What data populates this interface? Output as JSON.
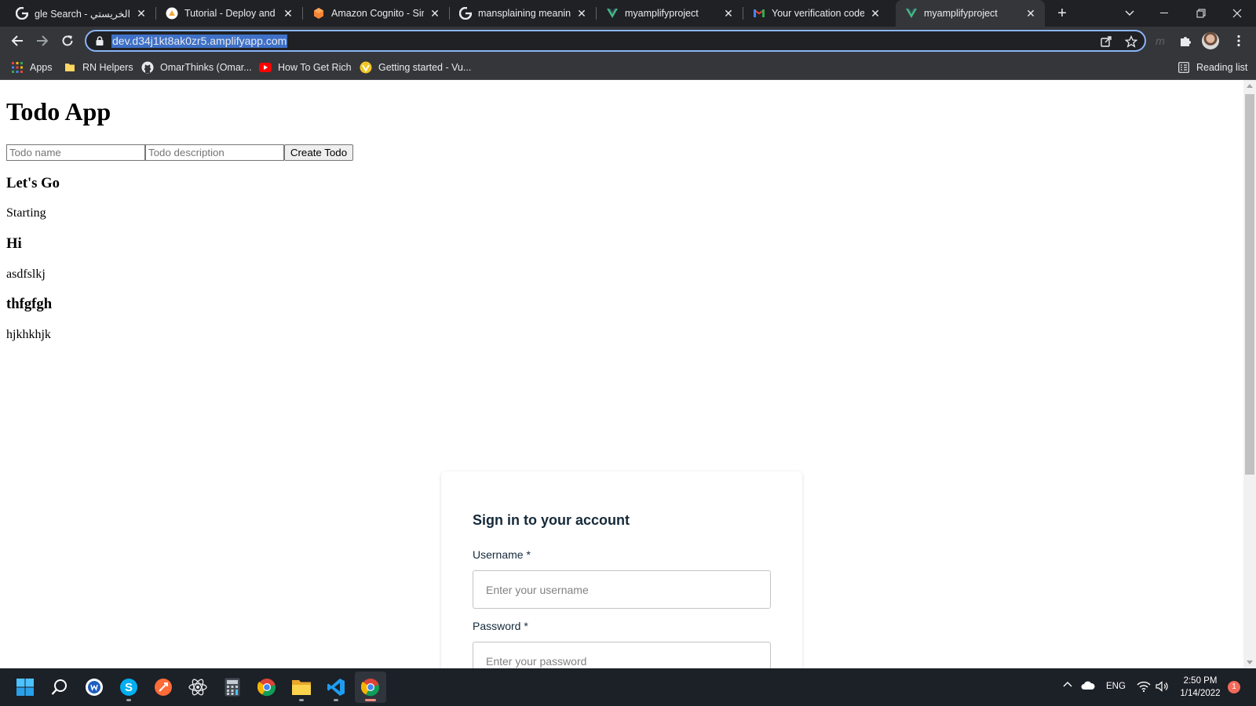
{
  "browser": {
    "tabs": [
      {
        "title": "الخريستي - Google Search",
        "favicon": "google-icon",
        "active": false
      },
      {
        "title": "Tutorial - Deploy and h",
        "favicon": "amplify-docs-icon",
        "active": false
      },
      {
        "title": "Amazon Cognito - Simp",
        "favicon": "aws-cognito-icon",
        "active": false
      },
      {
        "title": "mansplaining meaning",
        "favicon": "google-icon",
        "active": false
      },
      {
        "title": "myamplifyproject",
        "favicon": "vue-icon",
        "active": false
      },
      {
        "title": "Your verification code -",
        "favicon": "gmail-icon",
        "active": false
      },
      {
        "title": "myamplifyproject",
        "favicon": "vue-icon",
        "active": true
      }
    ],
    "url": "dev.d34j1kt8ak0zr5.amplifyapp.com",
    "bookmarks": [
      {
        "label": "Apps",
        "icon": "apps-grid-icon"
      },
      {
        "label": "RN Helpers",
        "icon": "folder-icon"
      },
      {
        "label": "OmarThinks (Omar...",
        "icon": "github-icon"
      },
      {
        "label": "How To Get Rich",
        "icon": "youtube-icon"
      },
      {
        "label": "Getting started - Vu...",
        "icon": "vuetify-icon"
      }
    ],
    "reading_list": "Reading list"
  },
  "app": {
    "title": "Todo App",
    "name_placeholder": "Todo name",
    "description_placeholder": "Todo description",
    "create_label": "Create Todo",
    "todos": [
      {
        "name": "Let's Go",
        "description": "Starting"
      },
      {
        "name": "Hi",
        "description": "asdfslkj"
      },
      {
        "name": "thfgfgh",
        "description": "hjkhkhjk"
      }
    ]
  },
  "auth": {
    "header": "Sign in to your account",
    "username_label": "Username *",
    "username_placeholder": "Enter your username",
    "password_label": "Password *",
    "password_placeholder": "Enter your password"
  },
  "taskbar": {
    "apps": [
      "windows-start-icon",
      "search-icon",
      "word-icon",
      "skype-icon",
      "postman-icon",
      "react-atom-icon",
      "calculator-icon",
      "chrome-icon",
      "file-explorer-icon",
      "vscode-icon",
      "chrome-icon"
    ],
    "language": "ENG",
    "time": "2:50 PM",
    "date": "1/14/2022",
    "notifications": "1"
  },
  "colors": {
    "tabstrip": "#202124",
    "toolbar": "#35363a",
    "omnibox_focus": "#8ab4f8",
    "url_selection": "#3e70c7",
    "taskbar": "#1c2027",
    "amplify_text": "#152939"
  }
}
